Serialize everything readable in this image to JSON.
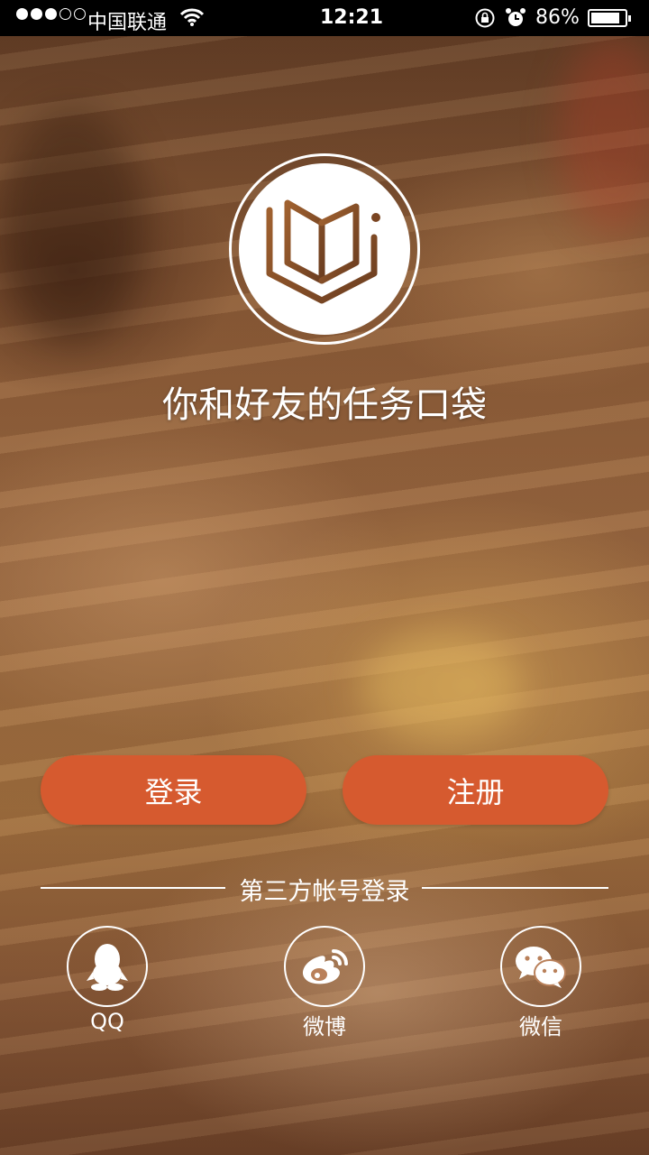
{
  "status_bar": {
    "carrier": "中国联通",
    "time": "12:21",
    "battery": "86%",
    "battery_level": 0.86,
    "signal_bars_filled": 3,
    "signal_bars_total": 5
  },
  "app": {
    "tagline": "你和好友的任务口袋",
    "logo_icon": "book-pocket-icon"
  },
  "actions": {
    "login_label": "登录",
    "register_label": "注册"
  },
  "third_party": {
    "divider_label": "第三方帐号登录",
    "providers": [
      {
        "label": "QQ",
        "icon": "qq-penguin-icon"
      },
      {
        "label": "微博",
        "icon": "weibo-icon"
      },
      {
        "label": "微信",
        "icon": "wechat-icon"
      }
    ]
  },
  "colors": {
    "accent": "#d65a2f",
    "logo_brown": "#8a4f2a"
  }
}
